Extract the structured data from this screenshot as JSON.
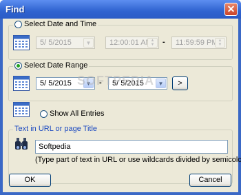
{
  "window": {
    "title": "Find",
    "close_glyph": "✕"
  },
  "date_time": {
    "label": "Select Date and Time",
    "selected": false,
    "date_value": "5/  5/2015",
    "time_from": "12:00:01 AM",
    "separator": "-",
    "time_to": "11:59:59 PM"
  },
  "date_range": {
    "label": "Select Date Range",
    "selected": true,
    "from": "5/  5/2015",
    "separator": "-",
    "to": "5/  5/2015",
    "more_button": ">"
  },
  "show_all": {
    "label": "Show All Entries",
    "selected": false
  },
  "text_search": {
    "label": "Text in URL or page Title",
    "value": "Softpedia",
    "hint": "(Type part of text in URL or use wildcards divided by semicolon)"
  },
  "buttons": {
    "ok": "OK",
    "cancel": "Cancel"
  },
  "watermark": "SOFTPEDIA",
  "colors": {
    "title_bar": "#2f63d0",
    "dialog_bg": "#ece9d8",
    "link_blue": "#1c4ac1",
    "radio_check": "#21a121"
  }
}
